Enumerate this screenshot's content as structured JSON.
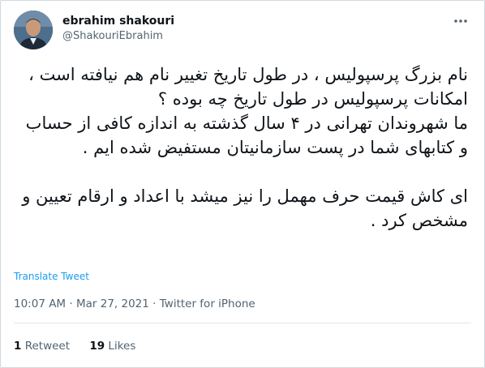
{
  "user": {
    "display_name": "ebrahim shakouri",
    "handle": "@ShakouriEbrahim"
  },
  "tweet": {
    "paragraphs": [
      "نام بزرگ پرسپولیس ، در طول تاریخ تغییر نام هم نیافته است ،",
      "امکانات پرسپولیس در طول تاریخ چه بوده ؟",
      "ما شهروندان تهرانی در ۴ سال گذشته به اندازه کافی از حساب و کتابهای شما در پست سازمانیتان مستفیض شده ایم .",
      "",
      "ای کاش قیمت حرف مهمل را نیز میشد با اعداد و ارقام تعیین و مشخص کرد ."
    ],
    "translate_label": "Translate Tweet"
  },
  "meta": {
    "time": "10:07 AM",
    "separator": "·",
    "date": "Mar 27, 2021",
    "source": "Twitter for iPhone"
  },
  "stats": {
    "retweets_count": "1",
    "retweets_label": "Retweet",
    "likes_count": "19",
    "likes_label": "Likes"
  },
  "icons": {
    "more": "more-horizontal-icon",
    "avatar": "avatar-photo"
  },
  "colors": {
    "link": "#1d9bf0",
    "secondary_text": "#536471",
    "primary_text": "#0f1419",
    "border": "#cfd9de"
  }
}
